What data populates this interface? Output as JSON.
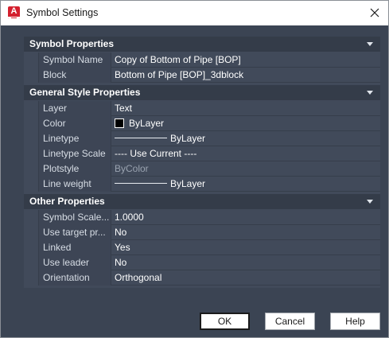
{
  "window": {
    "title": "Symbol Settings",
    "app_icon_letter": "A"
  },
  "sections": [
    {
      "header": "Symbol Properties",
      "rows": [
        {
          "label": "Symbol Name",
          "value": "Copy of Bottom of Pipe [BOP]"
        },
        {
          "label": "Block",
          "value": "Bottom of Pipe [BOP]_3dblock"
        }
      ]
    },
    {
      "header": "General Style Properties",
      "rows": [
        {
          "label": "Layer",
          "value": "Text"
        },
        {
          "label": "Color",
          "value": "ByLayer",
          "swatch": "#000000"
        },
        {
          "label": "Linetype",
          "value": "ByLayer"
        },
        {
          "label": "Linetype Scale",
          "value": "---- Use Current ----"
        },
        {
          "label": "Plotstyle",
          "value": "ByColor"
        },
        {
          "label": "Line weight",
          "value": "ByLayer"
        }
      ]
    },
    {
      "header": "Other Properties",
      "rows": [
        {
          "label": "Symbol  Scale...",
          "value": "1.0000"
        },
        {
          "label": "Use  target  pr...",
          "value": "No"
        },
        {
          "label": "Linked",
          "value": "Yes"
        },
        {
          "label": "Use leader",
          "value": "No"
        },
        {
          "label": "Orientation",
          "value": "Orthogonal"
        }
      ]
    }
  ],
  "buttons": {
    "ok": "OK",
    "cancel": "Cancel",
    "help": "Help"
  },
  "colors": {
    "panel_bg": "#414a5a",
    "header_bg": "#343c49",
    "dialog_bg": "#3b4453",
    "app_icon": "#d4202e"
  }
}
